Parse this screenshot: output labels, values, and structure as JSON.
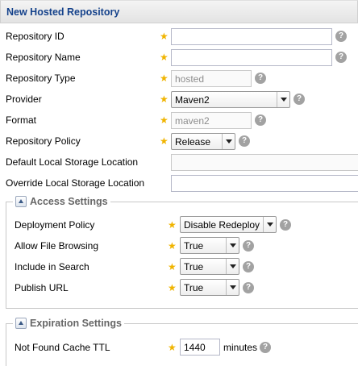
{
  "panel": {
    "title": "New Hosted Repository"
  },
  "fields": {
    "repository_id": {
      "label": "Repository ID",
      "value": ""
    },
    "repository_name": {
      "label": "Repository Name",
      "value": ""
    },
    "repository_type": {
      "label": "Repository Type",
      "value": "hosted"
    },
    "provider": {
      "label": "Provider",
      "value": "Maven2"
    },
    "format": {
      "label": "Format",
      "value": "maven2"
    },
    "repository_policy": {
      "label": "Repository Policy",
      "value": "Release"
    },
    "default_storage": {
      "label": "Default Local Storage Location",
      "value": ""
    },
    "override_storage": {
      "label": "Override Local Storage Location",
      "value": ""
    }
  },
  "access_settings": {
    "legend": "Access Settings",
    "deployment_policy": {
      "label": "Deployment Policy",
      "value": "Disable Redeploy"
    },
    "allow_file_browsing": {
      "label": "Allow File Browsing",
      "value": "True"
    },
    "include_in_search": {
      "label": "Include in Search",
      "value": "True"
    },
    "publish_url": {
      "label": "Publish URL",
      "value": "True"
    }
  },
  "expiration_settings": {
    "legend": "Expiration Settings",
    "not_found_cache_ttl": {
      "label": "Not Found Cache TTL",
      "value": "1440",
      "unit": "minutes"
    }
  },
  "icons": {
    "required": "star-icon",
    "help": "help-icon",
    "collapse": "collapse-icon"
  },
  "colors": {
    "title": "#15428b",
    "required_star": "#f0b400",
    "help_icon": "#a2a2a2"
  }
}
